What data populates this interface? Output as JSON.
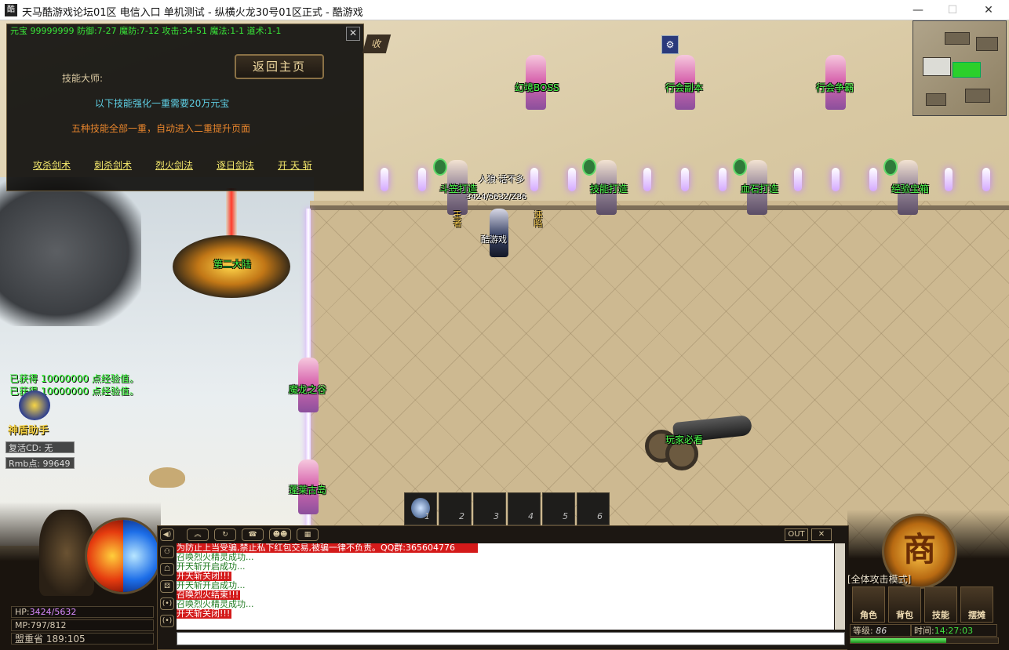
{
  "window": {
    "icon_text": "酷",
    "title": "天马酷游戏论坛01区 电信入口 单机测试 - 纵横火龙30号01区正式 - 酷游戏",
    "minimize": "—",
    "maximize": "☐",
    "close": "✕"
  },
  "skill_panel": {
    "stats": "元宝  99999999 防御:7-27 魔防:7-12 攻击:34-51 魔法:1-1 道术:1-1",
    "close": "✕",
    "home_button": "返回主页",
    "title": "技能大师:",
    "line1": "以下技能强化一重需要20万元宝",
    "line2": "五种技能全部一重，自动进入二重提升页面",
    "skills": [
      "攻杀剑术",
      "刺杀剑术",
      "烈火剑法",
      "逐日剑法",
      "开 天 斩"
    ],
    "side_tab": "收"
  },
  "npcs": {
    "row1": [
      "幻境BOSS",
      "行会副本",
      "行会争霸"
    ],
    "row2": [
      "斗笠打造",
      "技能打造",
      "血石打造",
      "经验宝箱"
    ],
    "left": [
      "魔龙之谷",
      "蓬莱古岛"
    ],
    "portal": "第二大陆",
    "cannon": "玩家必看"
  },
  "player": {
    "guild": "人狼·话不多",
    "hp_text": "3424/5632/Z86",
    "name": "酷游戏",
    "pet_left": "王者",
    "pet_right": "诬陷"
  },
  "left_info": {
    "gain1": "已获得 10000000 点经验值。",
    "gain2": "已获得 10000000 点经验值。",
    "helper": "神盾助手",
    "revive": "复活CD:   无",
    "rmb": "Rmb点: 99649"
  },
  "hotbar": [
    "1",
    "2",
    "3",
    "4",
    "5",
    "6"
  ],
  "status": {
    "hp_label": "HP:",
    "hp": "3424/5632",
    "mp_label": "MP:",
    "mp": "797/812",
    "location": "盟重省 189:105"
  },
  "chat": {
    "icons": [
      "◀)",
      "⚇",
      "☖",
      "⚄",
      "(•)",
      "(•)"
    ],
    "tabs": [
      "︽",
      "↻",
      "☎",
      "☻☻",
      "▦"
    ],
    "out": "OUT",
    "close": "✕",
    "lines": [
      {
        "text": "为防止上当受骗,禁止私下红包交易,被骗一律不负责。QQ群:365604776",
        "style": "sys"
      },
      {
        "text": "召唤烈火精灵成功...",
        "style": "green"
      },
      {
        "text": "开天斩开启成功...",
        "style": "green"
      },
      {
        "text": "开天斩关闭!!!",
        "style": "red"
      },
      {
        "text": "开天斩开启成功...",
        "style": "green"
      },
      {
        "text": "召唤烈火结束!!!",
        "style": "red"
      },
      {
        "text": "召唤烈火精灵成功...",
        "style": "green"
      },
      {
        "text": "开天斩关闭!!!",
        "style": "red"
      }
    ]
  },
  "right_panel": {
    "shop": "商",
    "attack_mode": "[全体攻击模式]",
    "buttons": [
      "角色",
      "背包",
      "技能",
      "摆摊"
    ],
    "level_label": "等级:",
    "level": "86",
    "time_label": "时间:",
    "time": "14:27:03",
    "exp_fraction": 0.65
  },
  "colors": {
    "npc_label": "#4cff4c",
    "skill_link": "#f4e86c",
    "chat_red": "#d41a1a",
    "chat_green": "#1f7a1f"
  }
}
